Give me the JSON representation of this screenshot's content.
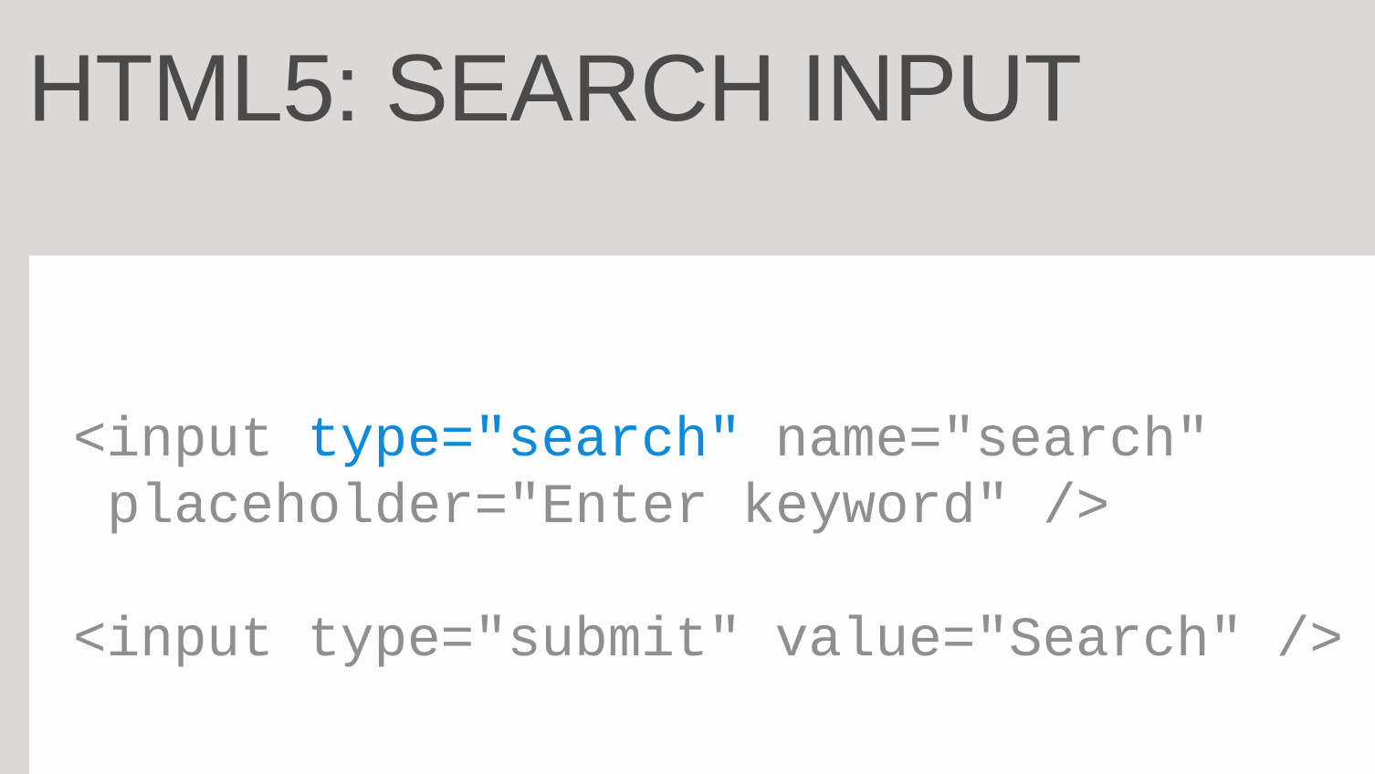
{
  "slide": {
    "title": "HTML5: SEARCH INPUT"
  },
  "code": {
    "line1": {
      "open": "<input ",
      "highlight": "type=\"search\"",
      "rest": " name=\"search\""
    },
    "line2": "placeholder=\"Enter keyword\" />",
    "line3": "<input type=\"submit\" value=\"Search\" />"
  },
  "colors": {
    "background": "#dcd8d5",
    "panel": "#fefefe",
    "title": "#4a4a4a",
    "code": "#8f8f8f",
    "highlight": "#0d8ad9"
  }
}
